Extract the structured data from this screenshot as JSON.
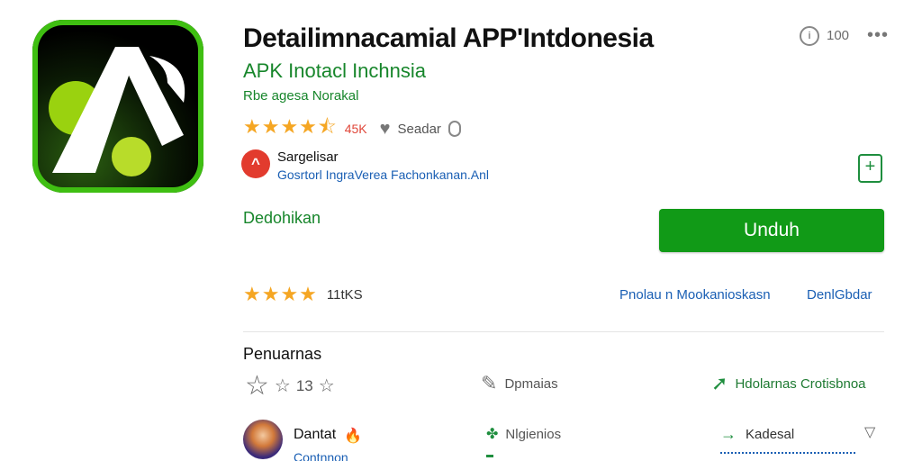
{
  "app": {
    "title": "Detailimnacamial APP'Intdonesia",
    "subtitle": "APK Inotacl Inchnsia",
    "subline": "Rbe agesa Norakal",
    "top_count": "100",
    "top_icon": "info-circle-icon",
    "rating_count": "45K",
    "rating_meta": "Seadar",
    "accent_color": "#119a17"
  },
  "developer": {
    "name": "Sargelisar",
    "description": "Gosrtorl IngraVerea Fachonkanan.Anl"
  },
  "recommend_label": "Dedohikan",
  "download_label": "Unduh",
  "rating_summary": {
    "value": "11tKS",
    "link_left": "Pnolau n Mookanioskasn",
    "link_right": "DenlGbdar"
  },
  "section": {
    "title": "Penuarnas",
    "stars_value": "13",
    "feature1": "Dpmaias",
    "feature2": "Hdolarnas Crotisbnoa",
    "feature3": "Nlgienios",
    "feature4": "Kadesal"
  },
  "review": {
    "name": "Dantat",
    "sub": "Contnnon"
  }
}
